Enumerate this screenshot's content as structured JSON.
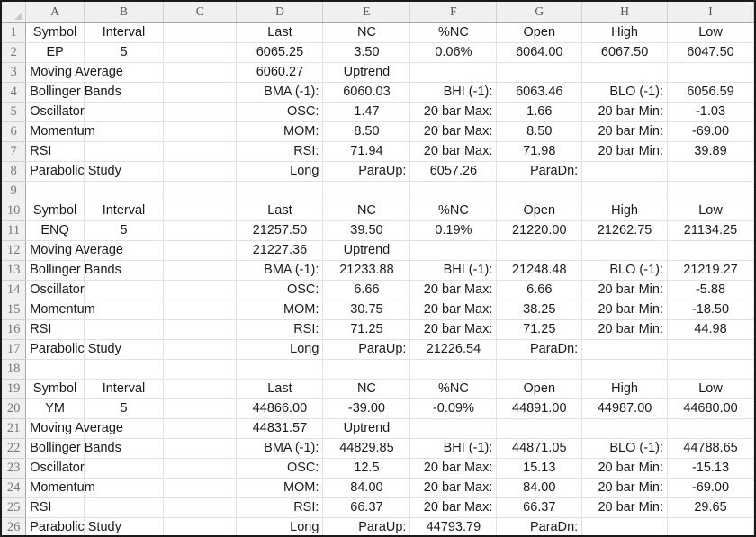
{
  "app": {
    "type": "spreadsheet",
    "select_all_icon": "select-all-triangle"
  },
  "columns": [
    "A",
    "B",
    "C",
    "D",
    "E",
    "F",
    "G",
    "H",
    "I"
  ],
  "row_numbers": [
    1,
    2,
    3,
    4,
    5,
    6,
    7,
    8,
    9,
    10,
    11,
    12,
    13,
    14,
    15,
    16,
    17,
    18,
    19,
    20,
    21,
    22,
    23,
    24,
    25,
    26
  ],
  "rows": [
    {
      "n": 1,
      "type": "header",
      "A": "Symbol",
      "B": "Interval",
      "C": "",
      "D": "Last",
      "E": "NC",
      "F": "%NC",
      "G": "Open",
      "H": "High",
      "I": "Low"
    },
    {
      "n": 2,
      "type": "quote",
      "A": "EP",
      "B": "5",
      "C": "",
      "D": "6065.25",
      "E": "3.50",
      "F": "0.06%",
      "G": "6064.00",
      "H": "6067.50",
      "I": "6047.50"
    },
    {
      "n": 3,
      "type": "study",
      "A": "Moving Average",
      "B": "",
      "C": "",
      "D": "6060.27",
      "E": "Uptrend",
      "F": "",
      "G": "",
      "H": "",
      "I": ""
    },
    {
      "n": 4,
      "type": "study",
      "A": "Bollinger Bands",
      "B": "",
      "C": "",
      "D": "BMA (-1):",
      "E": "6060.03",
      "F": "BHI (-1):",
      "G": "6063.46",
      "H": "BLO (-1):",
      "I": "6056.59"
    },
    {
      "n": 5,
      "type": "study",
      "A": "Oscillator",
      "B": "",
      "C": "",
      "D": "OSC:",
      "E": "1.47",
      "F": "20 bar Max:",
      "G": "1.66",
      "H": "20 bar Min:",
      "I": "-1.03"
    },
    {
      "n": 6,
      "type": "study",
      "A": "Momentum",
      "B": "",
      "C": "",
      "D": "MOM:",
      "E": "8.50",
      "F": "20 bar Max:",
      "G": "8.50",
      "H": "20 bar Min:",
      "I": "-69.00"
    },
    {
      "n": 7,
      "type": "study",
      "A": "RSI",
      "B": "",
      "C": "",
      "D": "RSI:",
      "E": "71.94",
      "F": "20 bar Max:",
      "G": "71.98",
      "H": "20 bar Min:",
      "I": "39.89"
    },
    {
      "n": 8,
      "type": "study",
      "A": "Parabolic Study",
      "B": "",
      "C": "",
      "D": "Long",
      "E": "ParaUp:",
      "F": "6057.26",
      "G": "ParaDn:",
      "H": "",
      "I": ""
    },
    {
      "n": 9,
      "type": "spacer",
      "A": "",
      "B": "",
      "C": "",
      "D": "",
      "E": "",
      "F": "",
      "G": "",
      "H": "",
      "I": ""
    },
    {
      "n": 10,
      "type": "header",
      "A": "Symbol",
      "B": "Interval",
      "C": "",
      "D": "Last",
      "E": "NC",
      "F": "%NC",
      "G": "Open",
      "H": "High",
      "I": "Low"
    },
    {
      "n": 11,
      "type": "quote",
      "A": "ENQ",
      "B": "5",
      "C": "",
      "D": "21257.50",
      "E": "39.50",
      "F": "0.19%",
      "G": "21220.00",
      "H": "21262.75",
      "I": "21134.25"
    },
    {
      "n": 12,
      "type": "study",
      "A": "Moving Average",
      "B": "",
      "C": "",
      "D": "21227.36",
      "E": "Uptrend",
      "F": "",
      "G": "",
      "H": "",
      "I": ""
    },
    {
      "n": 13,
      "type": "study",
      "A": "Bollinger Bands",
      "B": "",
      "C": "",
      "D": "BMA (-1):",
      "E": "21233.88",
      "F": "BHI (-1):",
      "G": "21248.48",
      "H": "BLO (-1):",
      "I": "21219.27"
    },
    {
      "n": 14,
      "type": "study",
      "A": "Oscillator",
      "B": "",
      "C": "",
      "D": "OSC:",
      "E": "6.66",
      "F": "20 bar Max:",
      "G": "6.66",
      "H": "20 bar Min:",
      "I": "-5.88"
    },
    {
      "n": 15,
      "type": "study",
      "A": "Momentum",
      "B": "",
      "C": "",
      "D": "MOM:",
      "E": "30.75",
      "F": "20 bar Max:",
      "G": "38.25",
      "H": "20 bar Min:",
      "I": "-18.50"
    },
    {
      "n": 16,
      "type": "study",
      "A": "RSI",
      "B": "",
      "C": "",
      "D": "RSI:",
      "E": "71.25",
      "F": "20 bar Max:",
      "G": "71.25",
      "H": "20 bar Min:",
      "I": "44.98"
    },
    {
      "n": 17,
      "type": "study",
      "A": "Parabolic Study",
      "B": "",
      "C": "",
      "D": "Long",
      "E": "ParaUp:",
      "F": "21226.54",
      "G": "ParaDn:",
      "H": "",
      "I": ""
    },
    {
      "n": 18,
      "type": "spacer",
      "A": "",
      "B": "",
      "C": "",
      "D": "",
      "E": "",
      "F": "",
      "G": "",
      "H": "",
      "I": ""
    },
    {
      "n": 19,
      "type": "header",
      "A": "Symbol",
      "B": "Interval",
      "C": "",
      "D": "Last",
      "E": "NC",
      "F": "%NC",
      "G": "Open",
      "H": "High",
      "I": "Low"
    },
    {
      "n": 20,
      "type": "quote",
      "A": "YM",
      "B": "5",
      "C": "",
      "D": "44866.00",
      "E": "-39.00",
      "F": "-0.09%",
      "G": "44891.00",
      "H": "44987.00",
      "I": "44680.00"
    },
    {
      "n": 21,
      "type": "study",
      "A": "Moving Average",
      "B": "",
      "C": "",
      "D": "44831.57",
      "E": "Uptrend",
      "F": "",
      "G": "",
      "H": "",
      "I": ""
    },
    {
      "n": 22,
      "type": "study",
      "A": "Bollinger Bands",
      "B": "",
      "C": "",
      "D": "BMA (-1):",
      "E": "44829.85",
      "F": "BHI (-1):",
      "G": "44871.05",
      "H": "BLO (-1):",
      "I": "44788.65"
    },
    {
      "n": 23,
      "type": "study",
      "A": "Oscillator",
      "B": "",
      "C": "",
      "D": "OSC:",
      "E": "12.5",
      "F": "20 bar Max:",
      "G": "15.13",
      "H": "20 bar Min:",
      "I": "-15.13"
    },
    {
      "n": 24,
      "type": "study",
      "A": "Momentum",
      "B": "",
      "C": "",
      "D": "MOM:",
      "E": "84.00",
      "F": "20 bar Max:",
      "G": "84.00",
      "H": "20 bar Min:",
      "I": "-69.00"
    },
    {
      "n": 25,
      "type": "study",
      "A": "RSI",
      "B": "",
      "C": "",
      "D": "RSI:",
      "E": "66.37",
      "F": "20 bar Max:",
      "G": "66.37",
      "H": "20 bar Min:",
      "I": "29.65"
    },
    {
      "n": 26,
      "type": "study",
      "A": "Parabolic Study",
      "B": "",
      "C": "",
      "D": "Long",
      "E": "ParaUp:",
      "F": "44793.79",
      "G": "ParaDn:",
      "H": "",
      "I": ""
    }
  ],
  "colors": {
    "grid_line": "#e2e2e2",
    "header_bg": "#f0f0f0",
    "header_text": "#555555",
    "cell_text": "#1a1a1a",
    "frame": "#1a1a1a"
  }
}
